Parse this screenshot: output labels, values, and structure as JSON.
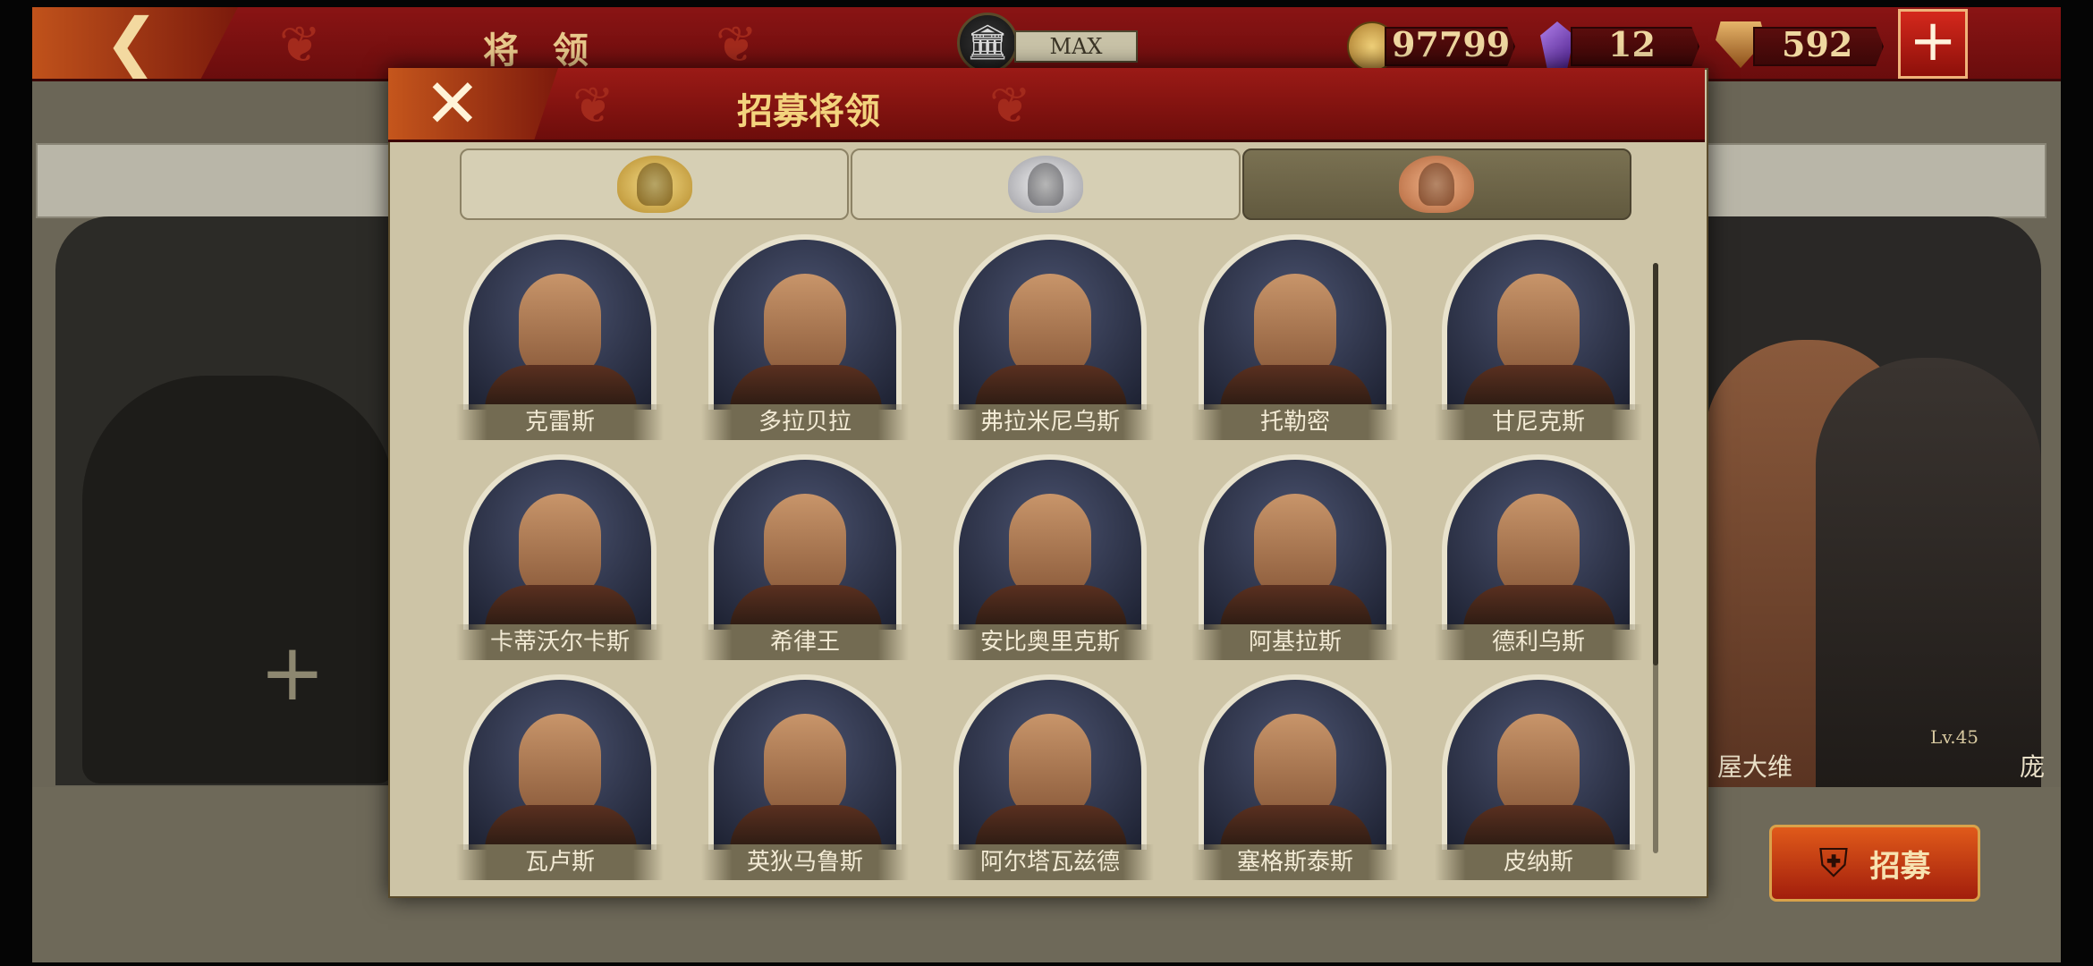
{
  "header": {
    "back_glyph": "❮",
    "title": "将 领",
    "building_glyph": "🏛",
    "level_label": "MAX",
    "coins": "97799",
    "gems": "12",
    "tokens": "592",
    "add_glyph": "+"
  },
  "background": {
    "add_slot_glyph": "+",
    "hero_name": "屋大维",
    "hero_level": "Lv.45",
    "hero_name_2": "庞",
    "recruit_label": "招募"
  },
  "modal": {
    "title": "招募将领",
    "close_glyph": "✕",
    "tabs": [
      {
        "tier": "gold"
      },
      {
        "tier": "silver"
      },
      {
        "tier": "bronze",
        "active": true
      }
    ],
    "generals": [
      {
        "name": "克雷斯"
      },
      {
        "name": "多拉贝拉"
      },
      {
        "name": "弗拉米尼乌斯"
      },
      {
        "name": "托勒密"
      },
      {
        "name": "甘尼克斯"
      },
      {
        "name": "卡蒂沃尔卡斯"
      },
      {
        "name": "希律王"
      },
      {
        "name": "安比奥里克斯"
      },
      {
        "name": "阿基拉斯"
      },
      {
        "name": "德利乌斯"
      },
      {
        "name": "瓦卢斯"
      },
      {
        "name": "英狄马鲁斯"
      },
      {
        "name": "阿尔塔瓦兹德"
      },
      {
        "name": "塞格斯泰斯"
      },
      {
        "name": "皮纳斯"
      }
    ]
  },
  "colors": {
    "banner_red": "#8a1414",
    "parchment": "#cdc4a6",
    "gold_text": "#f3d37d",
    "recruit_orange": "#e05a1a"
  }
}
